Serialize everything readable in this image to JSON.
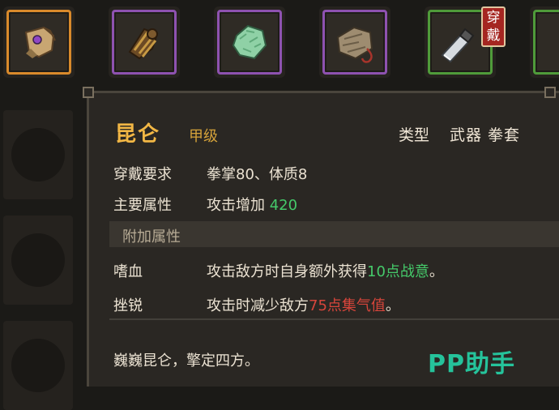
{
  "inventory": {
    "slots": [
      {
        "name": "glove-slot",
        "rarity": "orange"
      },
      {
        "name": "wrap-slot",
        "rarity": "purple"
      },
      {
        "name": "jade-slot",
        "rarity": "purple"
      },
      {
        "name": "stone-slot",
        "rarity": "purple"
      },
      {
        "name": "blade-slot",
        "rarity": "green"
      },
      {
        "name": "edge-slot",
        "rarity": "green"
      }
    ],
    "equipped_badge": "穿戴"
  },
  "tooltip": {
    "name": "昆仑",
    "grade": "甲级",
    "type_label": "类型",
    "type_value": "武器 拳套",
    "requirement_label": "穿戴要求",
    "requirement_value": "拳掌80、体质8",
    "main_attr_label": "主要属性",
    "main_attr_text": "攻击增加",
    "main_attr_num": "420",
    "section_title": "附加属性",
    "effects": [
      {
        "label": "嗜血",
        "prefix": "攻击敌方时自身额外获得",
        "highlight": "10点战意",
        "suffix": "。",
        "color": "green"
      },
      {
        "label": "挫锐",
        "prefix": "攻击时减少敌方",
        "highlight": "75点集气值",
        "suffix": "。",
        "color": "red"
      }
    ],
    "flavor_text": "巍巍昆仑，擎定四方。"
  },
  "watermark": "PP助手",
  "colors": {
    "title": "#f2b745",
    "green": "#45c96a",
    "red": "#d6453b",
    "panel": "#2a2723"
  }
}
